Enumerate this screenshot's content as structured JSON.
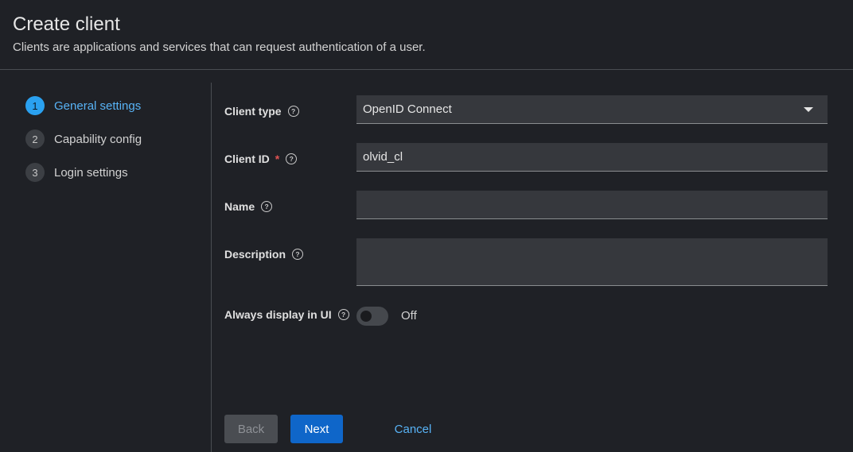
{
  "header": {
    "title": "Create client",
    "subtitle": "Clients are applications and services that can request authentication of a user."
  },
  "steps": [
    {
      "number": "1",
      "label": "General settings",
      "current": true
    },
    {
      "number": "2",
      "label": "Capability config",
      "current": false
    },
    {
      "number": "3",
      "label": "Login settings",
      "current": false
    }
  ],
  "form": {
    "client_type": {
      "label": "Client type",
      "value": "OpenID Connect"
    },
    "client_id": {
      "label": "Client ID",
      "required_mark": "*",
      "value": "olvid_cl"
    },
    "name": {
      "label": "Name",
      "value": ""
    },
    "description": {
      "label": "Description",
      "value": ""
    },
    "always_display": {
      "label": "Always display in UI",
      "state": "Off"
    },
    "help_glyph": "?"
  },
  "buttons": {
    "back": "Back",
    "next": "Next",
    "cancel": "Cancel"
  },
  "colors": {
    "background": "#1f2126",
    "accent": "#2aa1f0",
    "primary_button": "#0f66c9",
    "link": "#58b3f6",
    "required": "#e05353"
  }
}
